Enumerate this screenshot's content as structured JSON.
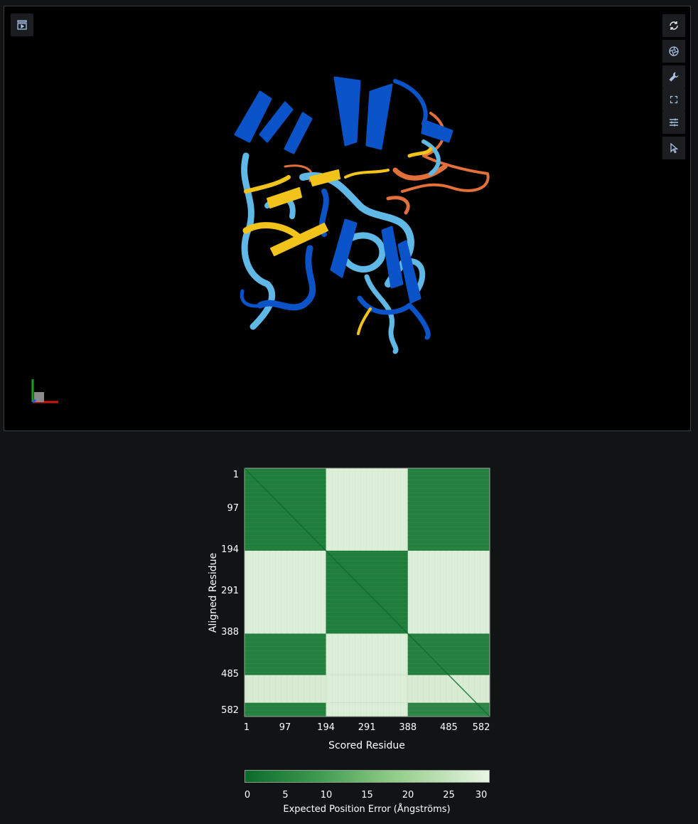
{
  "viewer": {
    "toolbar": [
      {
        "name": "reset-view-icon"
      },
      {
        "name": "snapshot-icon"
      },
      {
        "name": "wrench-icon"
      },
      {
        "name": "fullscreen-icon"
      },
      {
        "name": "settings-sliders-icon"
      },
      {
        "name": "select-cursor-icon"
      }
    ],
    "left_toggle": {
      "name": "sequence-panel-icon"
    },
    "chain_colors": {
      "very_high": "#0a53c8",
      "confident": "#5fb8e6",
      "low": "#f2c41b",
      "very_low": "#e2703a"
    }
  },
  "pae": {
    "y_label": "Aligned Residue",
    "x_label": "Scored Residue",
    "y_ticks": [
      "1",
      "97",
      "194",
      "291",
      "388",
      "485",
      "582"
    ],
    "x_ticks": [
      "1",
      "97",
      "194",
      "291",
      "388",
      "485",
      "582"
    ],
    "colorbar_label": "Expected Position Error (Ångströms)",
    "colorbar_ticks": [
      "0",
      "5",
      "10",
      "15",
      "20",
      "25",
      "30"
    ],
    "colors": {
      "low_error": "#0a6b2a",
      "high_error": "#e9f5e4"
    }
  },
  "chart_data": {
    "type": "heatmap",
    "title": "",
    "xlabel": "Scored Residue",
    "ylabel": "Aligned Residue",
    "x_ticks": [
      1,
      97,
      194,
      291,
      388,
      485,
      582
    ],
    "y_ticks": [
      1,
      97,
      194,
      291,
      388,
      485,
      582
    ],
    "color_range": [
      0,
      30
    ],
    "colorbar_label": "Expected Position Error (Ångströms)",
    "blocks": [
      {
        "rows": [
          1,
          194
        ],
        "cols": [
          1,
          194
        ],
        "value": 5
      },
      {
        "rows": [
          1,
          194
        ],
        "cols": [
          194,
          388
        ],
        "value": 29
      },
      {
        "rows": [
          1,
          194
        ],
        "cols": [
          388,
          582
        ],
        "value": 6
      },
      {
        "rows": [
          194,
          388
        ],
        "cols": [
          1,
          194
        ],
        "value": 28
      },
      {
        "rows": [
          194,
          388
        ],
        "cols": [
          194,
          388
        ],
        "value": 5
      },
      {
        "rows": [
          194,
          388
        ],
        "cols": [
          388,
          582
        ],
        "value": 28
      },
      {
        "rows": [
          388,
          485
        ],
        "cols": [
          1,
          194
        ],
        "value": 6
      },
      {
        "rows": [
          388,
          485
        ],
        "cols": [
          194,
          388
        ],
        "value": 28
      },
      {
        "rows": [
          388,
          485
        ],
        "cols": [
          388,
          582
        ],
        "value": 6
      },
      {
        "rows": [
          485,
          550
        ],
        "cols": [
          1,
          194
        ],
        "value": 27
      },
      {
        "rows": [
          485,
          550
        ],
        "cols": [
          194,
          388
        ],
        "value": 29
      },
      {
        "rows": [
          485,
          550
        ],
        "cols": [
          388,
          582
        ],
        "value": 27
      },
      {
        "rows": [
          550,
          582
        ],
        "cols": [
          1,
          194
        ],
        "value": 6
      },
      {
        "rows": [
          550,
          582
        ],
        "cols": [
          194,
          388
        ],
        "value": 28
      },
      {
        "rows": [
          550,
          582
        ],
        "cols": [
          388,
          582
        ],
        "value": 8
      }
    ]
  }
}
